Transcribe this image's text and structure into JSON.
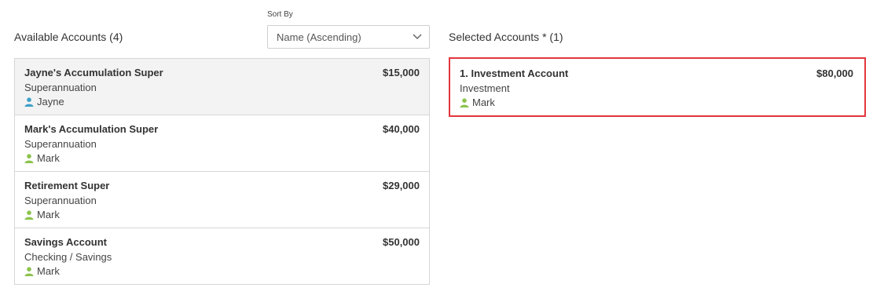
{
  "available": {
    "title": "Available Accounts (4)",
    "sort_label": "Sort By",
    "sort_value": "Name (Ascending)",
    "accounts": [
      {
        "name": "Jayne's Accumulation Super",
        "amount": "$15,000",
        "type": "Superannuation",
        "owner": "Jayne",
        "owner_color": "#3d9fc9"
      },
      {
        "name": "Mark's Accumulation Super",
        "amount": "$40,000",
        "type": "Superannuation",
        "owner": "Mark",
        "owner_color": "#8cc34b"
      },
      {
        "name": "Retirement Super",
        "amount": "$29,000",
        "type": "Superannuation",
        "owner": "Mark",
        "owner_color": "#8cc34b"
      },
      {
        "name": "Savings Account",
        "amount": "$50,000",
        "type": "Checking / Savings",
        "owner": "Mark",
        "owner_color": "#8cc34b"
      }
    ]
  },
  "selected": {
    "title": "Selected Accounts * (1)",
    "accounts": [
      {
        "name": "1. Investment Account",
        "amount": "$80,000",
        "type": "Investment",
        "owner": "Mark",
        "owner_color": "#8cc34b"
      }
    ]
  },
  "colors": {
    "selected_border": "#e2363c",
    "jayne": "#3d9fc9",
    "mark": "#8cc34b"
  },
  "icons": {
    "owner": "user-icon",
    "sort": "chevron-down-icon"
  }
}
